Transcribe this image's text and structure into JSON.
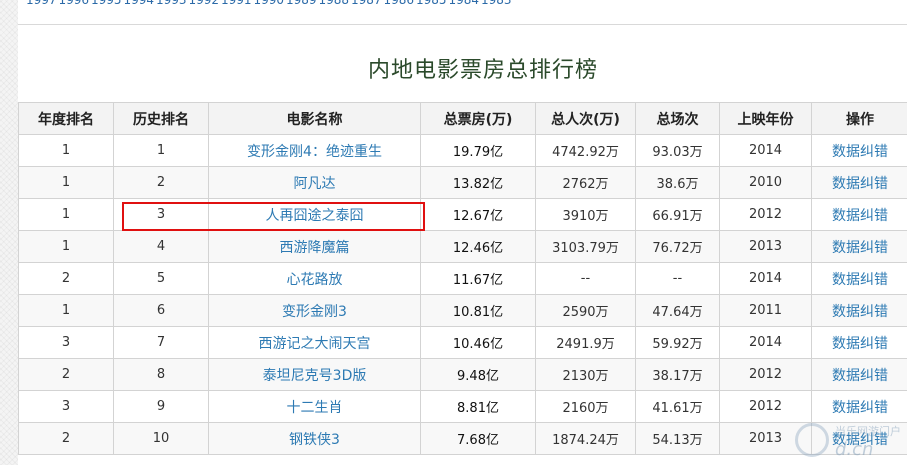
{
  "years": [
    "1997",
    "1996",
    "1995",
    "1994",
    "1993",
    "1992",
    "1991",
    "1990",
    "1989",
    "1988",
    "1987",
    "1986",
    "1985",
    "1984",
    "1983"
  ],
  "title": "内地电影票房总排行榜",
  "columns": [
    "年度排名",
    "历史排名",
    "电影名称",
    "总票房(万)",
    "总人次(万)",
    "总场次",
    "上映年份",
    "操作"
  ],
  "rows": [
    {
      "year_rank": "1",
      "hist_rank": "1",
      "name": "变形金刚4：绝迹重生",
      "gross": "19.79亿",
      "admissions": "4742.92万",
      "screenings": "93.03万",
      "year": "2014",
      "action": "数据纠错"
    },
    {
      "year_rank": "1",
      "hist_rank": "2",
      "name": "阿凡达",
      "gross": "13.82亿",
      "admissions": "2762万",
      "screenings": "38.6万",
      "year": "2010",
      "action": "数据纠错"
    },
    {
      "year_rank": "1",
      "hist_rank": "3",
      "name": "人再囧途之泰囧",
      "gross": "12.67亿",
      "admissions": "3910万",
      "screenings": "66.91万",
      "year": "2012",
      "action": "数据纠错"
    },
    {
      "year_rank": "1",
      "hist_rank": "4",
      "name": "西游降魔篇",
      "gross": "12.46亿",
      "admissions": "3103.79万",
      "screenings": "76.72万",
      "year": "2013",
      "action": "数据纠错"
    },
    {
      "year_rank": "2",
      "hist_rank": "5",
      "name": "心花路放",
      "gross": "11.67亿",
      "admissions": "--",
      "screenings": "--",
      "year": "2014",
      "action": "数据纠错"
    },
    {
      "year_rank": "1",
      "hist_rank": "6",
      "name": "变形金刚3",
      "gross": "10.81亿",
      "admissions": "2590万",
      "screenings": "47.64万",
      "year": "2011",
      "action": "数据纠错"
    },
    {
      "year_rank": "3",
      "hist_rank": "7",
      "name": "西游记之大闹天宫",
      "gross": "10.46亿",
      "admissions": "2491.9万",
      "screenings": "59.92万",
      "year": "2014",
      "action": "数据纠错"
    },
    {
      "year_rank": "2",
      "hist_rank": "8",
      "name": "泰坦尼克号3D版",
      "gross": "9.48亿",
      "admissions": "2130万",
      "screenings": "38.17万",
      "year": "2012",
      "action": "数据纠错"
    },
    {
      "year_rank": "3",
      "hist_rank": "9",
      "name": "十二生肖",
      "gross": "8.81亿",
      "admissions": "2160万",
      "screenings": "41.61万",
      "year": "2012",
      "action": "数据纠错"
    },
    {
      "year_rank": "2",
      "hist_rank": "10",
      "name": "钢铁侠3",
      "gross": "7.68亿",
      "admissions": "1874.24万",
      "screenings": "54.13万",
      "year": "2013",
      "action": "数据纠错"
    }
  ],
  "watermark": {
    "line1": "当乐网游门户",
    "line2": "d.cn"
  },
  "colors": {
    "link": "#2d7ab3",
    "highlight_border": "#e01010",
    "header_bg": "#f3f3f3"
  }
}
